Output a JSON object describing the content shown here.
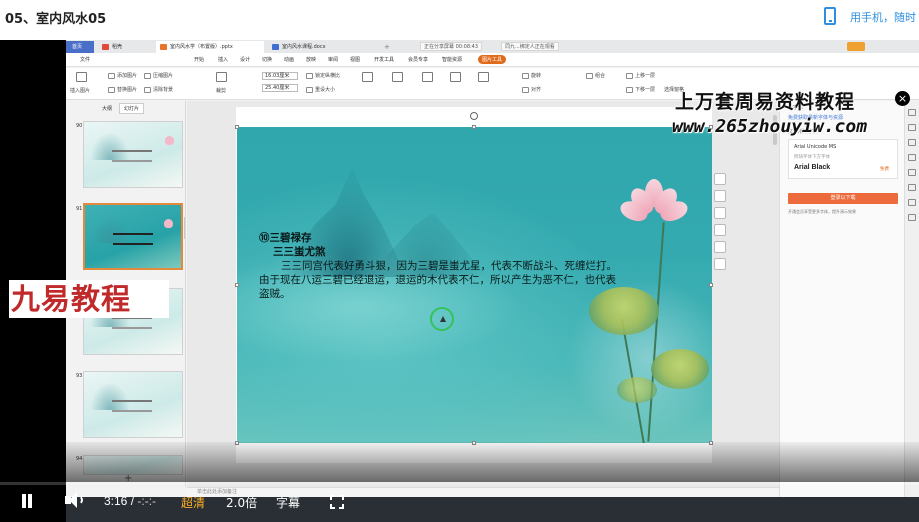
{
  "header": {
    "title": "05、室内风水05",
    "mobile_link": "用手机，随时"
  },
  "wps": {
    "tabs": {
      "home": "首页",
      "templates": "稻壳",
      "ppt": "室内风水学（布置版）.pptx",
      "doc": "室内风水课程.docx"
    },
    "notice_1": "正在分享屏幕   00:08:43",
    "notice_2": "同九...绑定人正在观看",
    "menu": [
      "文件",
      "开始",
      "插入",
      "设计",
      "切换",
      "动画",
      "放映",
      "审阅",
      "视图",
      "开发工具",
      "会员专享",
      "智能资源"
    ],
    "menu_active": "图片工具",
    "ribbon": {
      "insert_image": "插入图片",
      "add_image": "添加图片",
      "replace_image": "替换图片",
      "compress": "压缩图片",
      "clear": "清除背景",
      "crop": "裁剪",
      "height": "16.03厘米",
      "width": "25.40厘米",
      "lock_ratio": "锁定纵横比",
      "reset_size": "重设大小",
      "rotate": "旋转",
      "align": "对齐",
      "group": "组合",
      "up_one": "上移一层",
      "down_one": "下移一层",
      "select": "选择窗格"
    },
    "thumbs": {
      "tab_outline": "大纲",
      "tab_slides": "幻灯片",
      "numbers": [
        "90",
        "91",
        "92",
        "93",
        "94"
      ]
    },
    "slide": {
      "heading": "⑩三碧禄存",
      "subheading": "三三蚩尤煞",
      "body": "三三同宫代表好勇斗狠，因为三碧是蚩尤星，代表不断战斗、死缠烂打。由于现在八运三碧已经退运，退运的木代表不仁，所以产生为恶不仁，也代表盗贼。"
    },
    "notes_placeholder": "单击此处添加备注",
    "panel": {
      "title": "云字体",
      "subtitle": "免费获取最新字体与资源",
      "label": "文档所缺字体",
      "font_line1": "Arial Unicode MS",
      "font_line2": "所缺字体下方字体",
      "font_name": "Arial Black",
      "font_tag": "免费",
      "button": "登录以下载",
      "note": "开通会员享受更多字体，提升演示效果"
    }
  },
  "watermarks": {
    "left": "九易教程",
    "right_title": "上万套周易资料教程",
    "right_url": "www.265zhouyiw.com"
  },
  "player": {
    "current": "3:16",
    "separator": "/",
    "duration": "-:-:-",
    "quality": "超清",
    "speed": "2.0倍",
    "subtitle": "字幕",
    "progress": 0.0
  }
}
